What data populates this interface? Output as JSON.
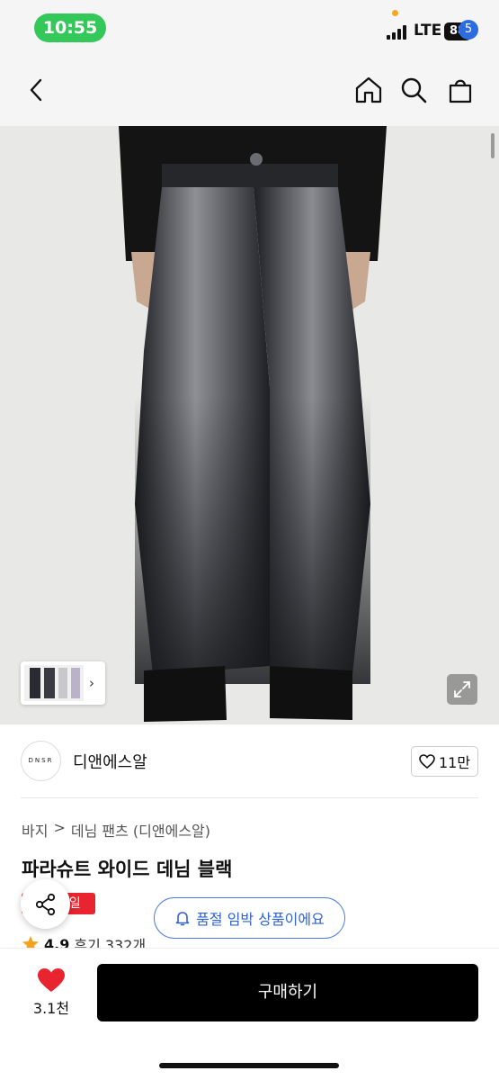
{
  "status_bar": {
    "time": "10:55",
    "network": "LTE",
    "battery": "88"
  },
  "header": {
    "cart_count": "5"
  },
  "brand": {
    "logo_text": "DNSR",
    "name": "디앤에스알",
    "likes": "11만"
  },
  "breadcrumb": {
    "category": "바지",
    "separator": ">",
    "subcategory": "데님 팬츠 (디앤에스알)"
  },
  "product": {
    "title": "파라슈트 와이드 데님 블랙",
    "sale_badge": "세일",
    "stock_alert": "품절 임박 상품이에요",
    "rating": "4.9",
    "reviews": "후기 332개"
  },
  "bottom_bar": {
    "favorites": "3.1천",
    "buy_label": "구매하기"
  },
  "colors": {
    "accent_blue": "#2f63cf",
    "sale_red": "#e8242f",
    "status_green": "#34c759",
    "heart_red": "#e8242f",
    "buy_black": "#000000"
  },
  "icons": [
    "back-icon",
    "home-icon",
    "search-icon",
    "cart-icon",
    "expand-icon",
    "heart-outline-icon",
    "share-icon",
    "bell-icon",
    "star-icon",
    "heart-filled-icon"
  ]
}
